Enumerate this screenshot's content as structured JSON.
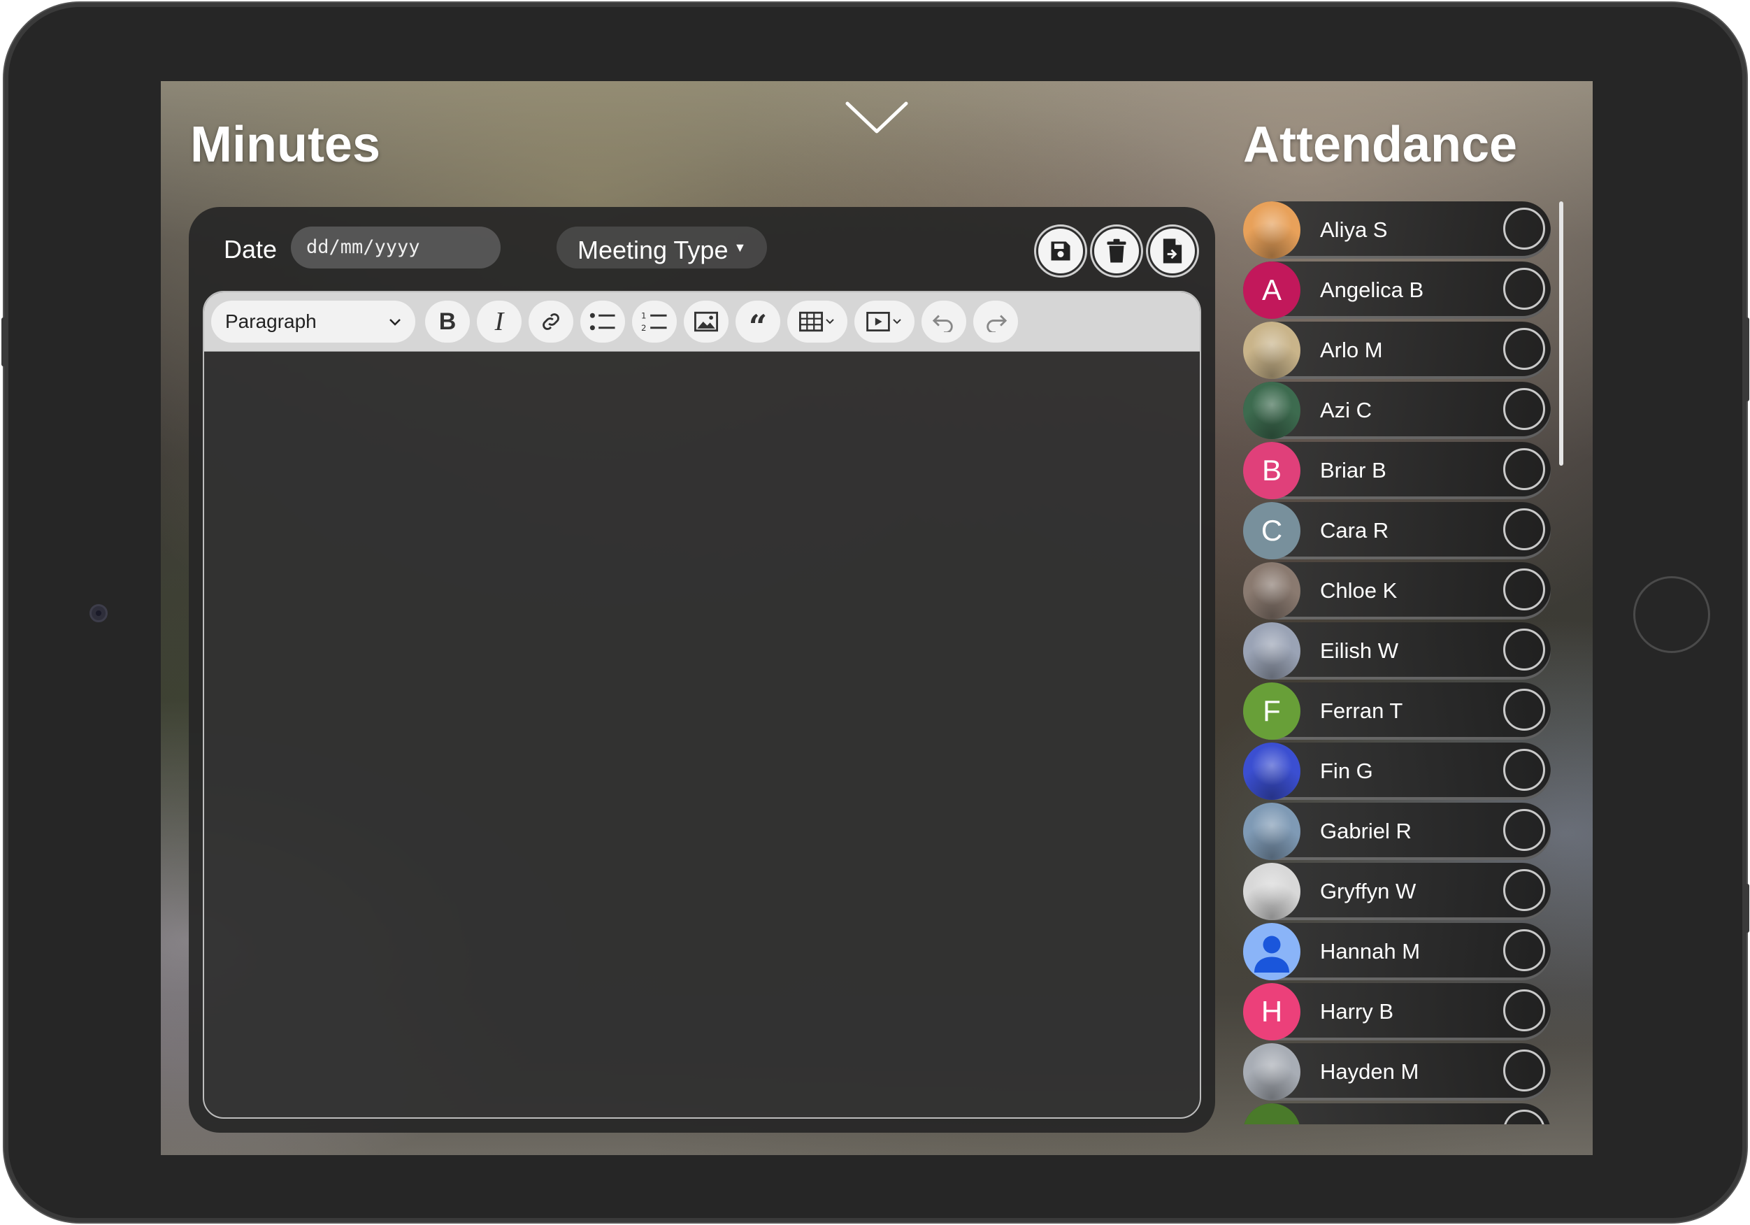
{
  "header": {
    "minutes_title": "Minutes",
    "attendance_title": "Attendance",
    "collapse_icon": "chevron-down-icon"
  },
  "minutes": {
    "date_label": "Date",
    "date_placeholder": "dd/mm/yyyy",
    "meeting_type_label": "Meeting Type",
    "actions": [
      "save-icon",
      "trash-icon",
      "export-file-icon"
    ]
  },
  "editor": {
    "block_format": "Paragraph",
    "toolbar": [
      "bold",
      "italic",
      "link",
      "bulleted-list",
      "numbered-list",
      "image",
      "blockquote",
      "table",
      "media",
      "undo",
      "redo"
    ],
    "content": ""
  },
  "attendance": {
    "members": [
      {
        "name": "Aliya S",
        "avatar": "photo",
        "color": "#e8a15a"
      },
      {
        "name": "Angelica B",
        "avatar": "A",
        "color": "#c2185b"
      },
      {
        "name": "Arlo M",
        "avatar": "photo",
        "color": "#c9b48a"
      },
      {
        "name": "Azi C",
        "avatar": "photo",
        "color": "#3d6b4f"
      },
      {
        "name": "Briar B",
        "avatar": "B",
        "color": "#e0407a"
      },
      {
        "name": "Cara R",
        "avatar": "C",
        "color": "#78909c"
      },
      {
        "name": "Chloe K",
        "avatar": "photo",
        "color": "#8a7a70"
      },
      {
        "name": "Eilish W",
        "avatar": "photo",
        "color": "#9aa3b5"
      },
      {
        "name": "Ferran T",
        "avatar": "F",
        "color": "#689f38"
      },
      {
        "name": "Fin G",
        "avatar": "photo",
        "color": "#3b4fd1"
      },
      {
        "name": "Gabriel R",
        "avatar": "photo",
        "color": "#7f9ab5"
      },
      {
        "name": "Gryffyn W",
        "avatar": "photo",
        "color": "#d8d8d8"
      },
      {
        "name": "Hannah M",
        "avatar": "person",
        "color": "#8ab4f8"
      },
      {
        "name": "Harry B",
        "avatar": "H",
        "color": "#ec407a"
      },
      {
        "name": "Hayden M",
        "avatar": "photo",
        "color": "#a8adb5"
      },
      {
        "name": "",
        "avatar": "",
        "color": "#4a7a2a"
      }
    ]
  }
}
